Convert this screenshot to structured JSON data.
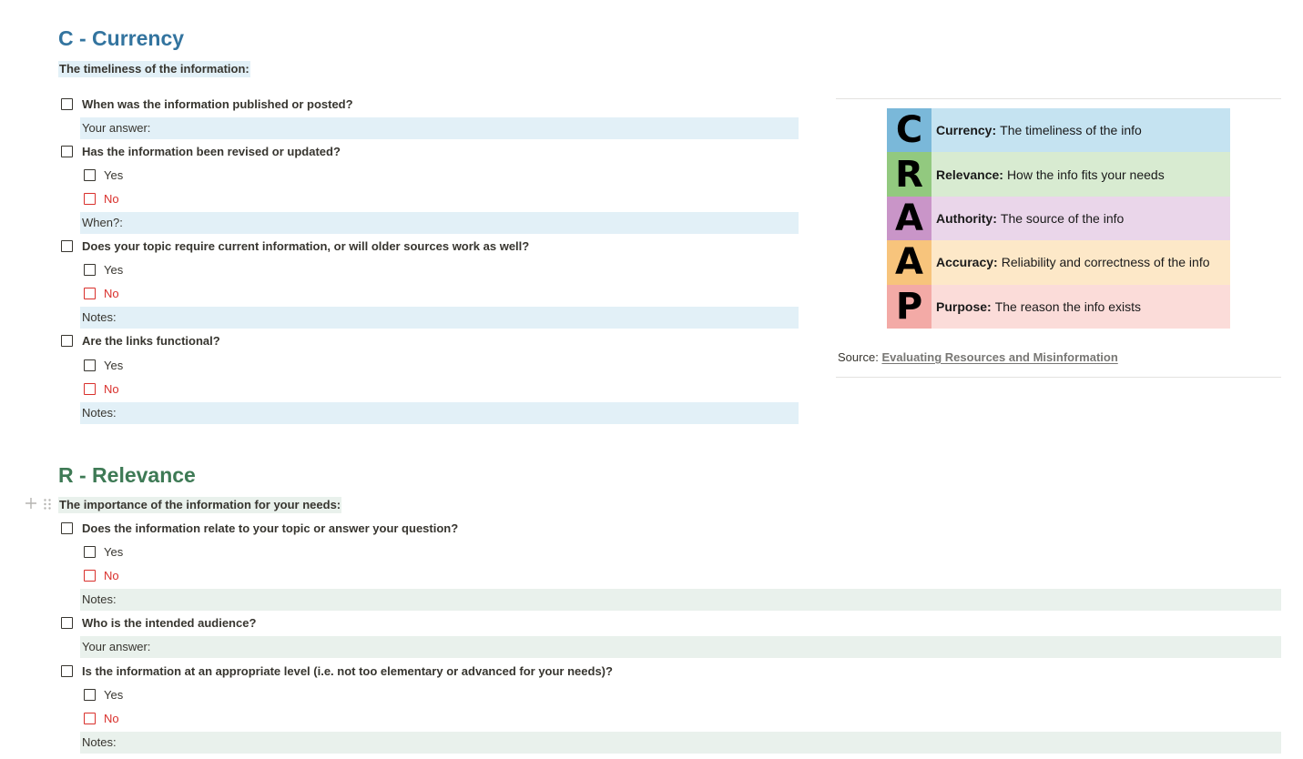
{
  "currency": {
    "title": "C - Currency",
    "title_color": "#33749f",
    "subtitle": "The timeliness of the information:",
    "subtitle_bg": "#e2f0f7",
    "q1": "When was the information published or posted?",
    "q1_note": "Your answer:",
    "q2": "Has the information been revised or updated?",
    "q2_yes": "Yes",
    "q2_no": "No",
    "q2_note": "When?:",
    "q3": "Does your topic require current information, or will older sources work as well?",
    "q3_yes": "Yes",
    "q3_no": "No",
    "q3_note": "Notes:",
    "q4": "Are the links functional?",
    "q4_yes": "Yes",
    "q4_no": "No",
    "q4_note": "Notes:"
  },
  "relevance": {
    "title": "R - Relevance",
    "title_color": "#3e7a55",
    "subtitle": "The importance of the information for your needs:",
    "subtitle_bg": "#e9f1ec",
    "q1": "Does the information relate to your topic or answer your question?",
    "q1_yes": "Yes",
    "q1_no": "No",
    "q1_note": "Notes:",
    "q2": "Who is the intended audience?",
    "q2_note": "Your answer:",
    "q3": "Is the information at an appropriate level (i.e. not too elementary or advanced for your needs)?",
    "q3_yes": "Yes",
    "q3_no": "No",
    "q3_note": "Notes:"
  },
  "crap_image": {
    "rows": [
      {
        "letter": "C",
        "term": "Currency:",
        "desc": "The timeliness of the info",
        "letter_bg": "#7ab8d9",
        "bg": "#c5e3f1"
      },
      {
        "letter": "R",
        "term": "Relevance:",
        "desc": "How the info fits your needs",
        "letter_bg": "#92c97f",
        "bg": "#d8ebd1"
      },
      {
        "letter": "A",
        "term": "Authority:",
        "desc": "The source of the info",
        "letter_bg": "#c995c8",
        "bg": "#ead6ea"
      },
      {
        "letter": "A",
        "term": "Accuracy:",
        "desc": "Reliability and correctness of the info",
        "letter_bg": "#f7c47c",
        "bg": "#fde8c8"
      },
      {
        "letter": "P",
        "term": "Purpose:",
        "desc": "The reason the info exists",
        "letter_bg": "#f3aaa6",
        "bg": "#fbdcd9"
      }
    ]
  },
  "source": {
    "label": "Source:",
    "link": "Evaluating Resources and Misinformation"
  },
  "icons": {
    "add": "plus-icon",
    "drag": "drag-handle-icon"
  }
}
